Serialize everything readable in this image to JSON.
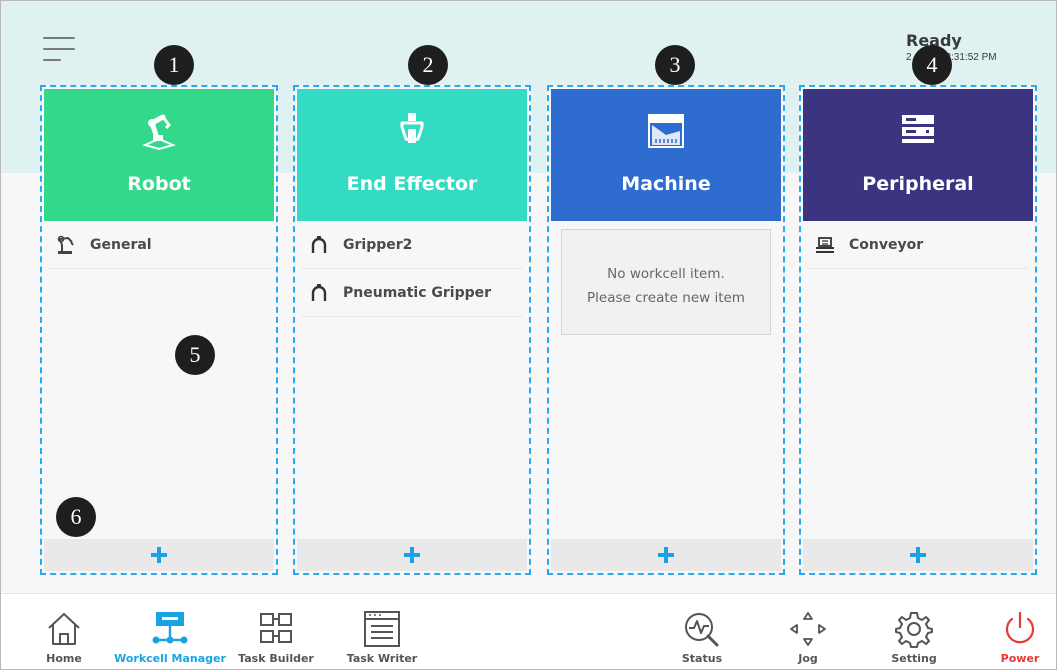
{
  "header": {
    "menu_icon": "hamburger-icon",
    "status": "Ready",
    "datetime": "2……26 2:31:52 PM"
  },
  "markers": [
    "1",
    "2",
    "3",
    "4",
    "5",
    "6"
  ],
  "columns": [
    {
      "title": "Robot",
      "icon": "robot-arm-icon",
      "color": "#32d98a",
      "items": [
        {
          "label": "General",
          "icon": "robot-icon"
        }
      ]
    },
    {
      "title": "End Effector",
      "icon": "gripper-icon",
      "color": "#33dbc2",
      "items": [
        {
          "label": "Gripper2",
          "icon": "gripper-small-icon"
        },
        {
          "label": "Pneumatic Gripper",
          "icon": "gripper-small-icon"
        }
      ]
    },
    {
      "title": "Machine",
      "icon": "machine-icon",
      "color": "#2f6cd0",
      "items": [],
      "empty_line1": "No workcell item.",
      "empty_line2": "Please create new item"
    },
    {
      "title": "Peripheral",
      "icon": "peripheral-icon",
      "color": "#3b3480",
      "items": [
        {
          "label": "Conveyor",
          "icon": "conveyor-icon"
        }
      ]
    }
  ],
  "add_icon": "plus-icon",
  "accent": "#1aa3e2",
  "nav": {
    "home": "Home",
    "workcell_manager": "Workcell Manager",
    "task_builder": "Task Builder",
    "task_writer": "Task Writer",
    "status": "Status",
    "jog": "Jog",
    "setting": "Setting",
    "power": "Power",
    "active_color": "#1aa3e2",
    "power_color": "#e53935"
  }
}
